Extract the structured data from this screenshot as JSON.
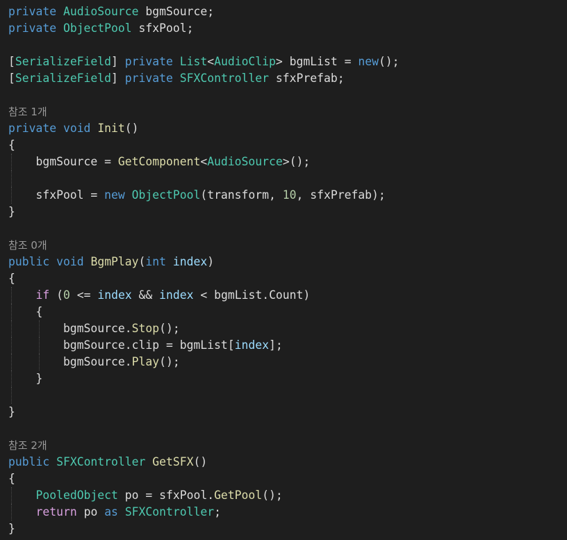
{
  "editor": {
    "lines": [
      {
        "tokens": [
          [
            "kw",
            "private"
          ],
          [
            "tx",
            " "
          ],
          [
            "ty",
            "AudioSource"
          ],
          [
            "tx",
            " bgmSource;"
          ]
        ]
      },
      {
        "tokens": [
          [
            "kw",
            "private"
          ],
          [
            "tx",
            " "
          ],
          [
            "ty",
            "ObjectPool"
          ],
          [
            "tx",
            " sfxPool;"
          ]
        ]
      },
      {
        "blank": true
      },
      {
        "tokens": [
          [
            "tx",
            "["
          ],
          [
            "ty",
            "SerializeField"
          ],
          [
            "tx",
            "] "
          ],
          [
            "kw",
            "private"
          ],
          [
            "tx",
            " "
          ],
          [
            "ty",
            "List"
          ],
          [
            "tx",
            "<"
          ],
          [
            "ty",
            "AudioClip"
          ],
          [
            "tx",
            "> bgmList = "
          ],
          [
            "kw",
            "new"
          ],
          [
            "tx",
            "();"
          ]
        ]
      },
      {
        "tokens": [
          [
            "tx",
            "["
          ],
          [
            "ty",
            "SerializeField"
          ],
          [
            "tx",
            "] "
          ],
          [
            "kw",
            "private"
          ],
          [
            "tx",
            " "
          ],
          [
            "ty",
            "SFXController"
          ],
          [
            "tx",
            " sfxPrefab;"
          ]
        ]
      },
      {
        "blank": true
      },
      {
        "ref": "참조 1개"
      },
      {
        "tokens": [
          [
            "kw",
            "private"
          ],
          [
            "tx",
            " "
          ],
          [
            "kw",
            "void"
          ],
          [
            "tx",
            " "
          ],
          [
            "fn",
            "Init"
          ],
          [
            "tx",
            "()"
          ]
        ]
      },
      {
        "tokens": [
          [
            "tx",
            "{"
          ]
        ]
      },
      {
        "guides": 1,
        "tokens": [
          [
            "tx",
            "    bgmSource = "
          ],
          [
            "fn",
            "GetComponent"
          ],
          [
            "tx",
            "<"
          ],
          [
            "ty",
            "AudioSource"
          ],
          [
            "tx",
            ">();"
          ]
        ]
      },
      {
        "guides": 1,
        "tokens": [
          [
            "tx",
            ""
          ]
        ]
      },
      {
        "guides": 1,
        "tokens": [
          [
            "tx",
            "    sfxPool = "
          ],
          [
            "kw",
            "new"
          ],
          [
            "tx",
            " "
          ],
          [
            "ty",
            "ObjectPool"
          ],
          [
            "tx",
            "(transform, "
          ],
          [
            "nm",
            "10"
          ],
          [
            "tx",
            ", sfxPrefab);"
          ]
        ]
      },
      {
        "tokens": [
          [
            "tx",
            "}"
          ]
        ]
      },
      {
        "blank": true
      },
      {
        "ref": "참조 0개"
      },
      {
        "tokens": [
          [
            "kw",
            "public"
          ],
          [
            "tx",
            " "
          ],
          [
            "kw",
            "void"
          ],
          [
            "tx",
            " "
          ],
          [
            "fn",
            "BgmPlay"
          ],
          [
            "tx",
            "("
          ],
          [
            "kw",
            "int"
          ],
          [
            "tx",
            " "
          ],
          [
            "pm",
            "index"
          ],
          [
            "tx",
            ")"
          ]
        ]
      },
      {
        "tokens": [
          [
            "tx",
            "{"
          ]
        ]
      },
      {
        "guides": 1,
        "tokens": [
          [
            "tx",
            "    "
          ],
          [
            "ctl",
            "if"
          ],
          [
            "tx",
            " ("
          ],
          [
            "nm",
            "0"
          ],
          [
            "tx",
            " <= "
          ],
          [
            "pm",
            "index"
          ],
          [
            "tx",
            " && "
          ],
          [
            "pm",
            "index"
          ],
          [
            "tx",
            " < bgmList.Count)"
          ]
        ]
      },
      {
        "guides": 1,
        "tokens": [
          [
            "tx",
            "    {"
          ]
        ]
      },
      {
        "guides": 2,
        "tokens": [
          [
            "tx",
            "        bgmSource."
          ],
          [
            "fn",
            "Stop"
          ],
          [
            "tx",
            "();"
          ]
        ]
      },
      {
        "guides": 2,
        "tokens": [
          [
            "tx",
            "        bgmSource.clip = bgmList["
          ],
          [
            "pm",
            "index"
          ],
          [
            "tx",
            "];"
          ]
        ]
      },
      {
        "guides": 2,
        "tokens": [
          [
            "tx",
            "        bgmSource."
          ],
          [
            "fn",
            "Play"
          ],
          [
            "tx",
            "();"
          ]
        ]
      },
      {
        "guides": 1,
        "tokens": [
          [
            "tx",
            "    }"
          ]
        ]
      },
      {
        "guides": 1,
        "tokens": [
          [
            "tx",
            ""
          ]
        ]
      },
      {
        "tokens": [
          [
            "tx",
            "}"
          ]
        ]
      },
      {
        "blank": true
      },
      {
        "ref": "참조 2개"
      },
      {
        "tokens": [
          [
            "kw",
            "public"
          ],
          [
            "tx",
            " "
          ],
          [
            "ty",
            "SFXController"
          ],
          [
            "tx",
            " "
          ],
          [
            "fn",
            "GetSFX"
          ],
          [
            "tx",
            "()"
          ]
        ]
      },
      {
        "tokens": [
          [
            "tx",
            "{"
          ]
        ]
      },
      {
        "guides": 1,
        "tokens": [
          [
            "tx",
            "    "
          ],
          [
            "ty",
            "PooledObject"
          ],
          [
            "tx",
            " po = sfxPool."
          ],
          [
            "fn",
            "GetPool"
          ],
          [
            "tx",
            "();"
          ]
        ]
      },
      {
        "guides": 1,
        "tokens": [
          [
            "tx",
            "    "
          ],
          [
            "ctl",
            "return"
          ],
          [
            "tx",
            " po "
          ],
          [
            "kw",
            "as"
          ],
          [
            "tx",
            " "
          ],
          [
            "ty",
            "SFXController"
          ],
          [
            "tx",
            ";"
          ]
        ]
      },
      {
        "tokens": [
          [
            "tx",
            "}"
          ]
        ]
      }
    ]
  }
}
